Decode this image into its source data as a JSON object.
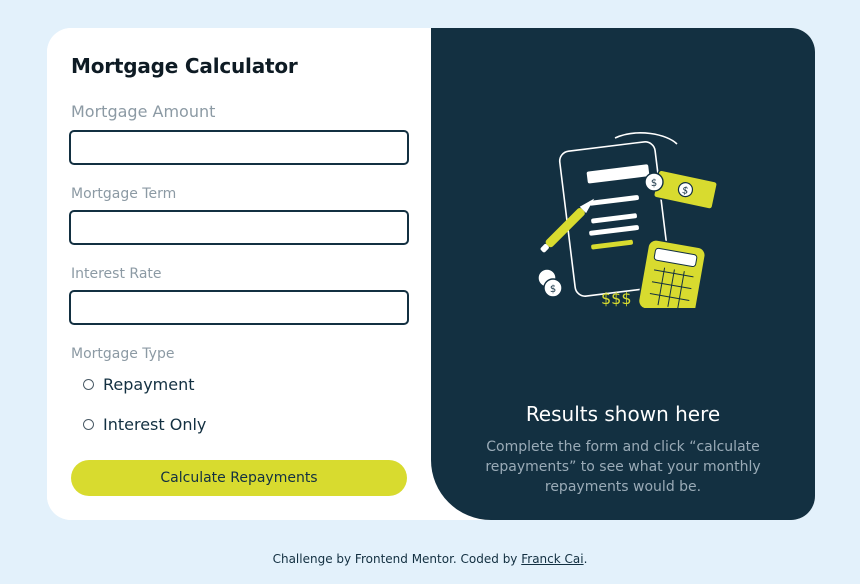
{
  "form": {
    "title": "Mortgage Calculator",
    "amount_label": "Mortgage Amount",
    "term_label": "Mortgage Term",
    "rate_label": "Interest Rate",
    "type_label": "Mortgage Type",
    "amount_value": "",
    "term_value": "",
    "rate_value": "",
    "options": [
      {
        "label": "Repayment",
        "selected": false
      },
      {
        "label": "Interest Only",
        "selected": false
      }
    ],
    "submit_label": "Calculate Repayments"
  },
  "results": {
    "title": "Results shown here",
    "description": "Complete the form and click “calculate repayments” to see what your monthly repayments would be."
  },
  "footer": {
    "prefix": "Challenge by Frontend Mentor. Coded by ",
    "author": "Franck Cai",
    "suffix": "."
  },
  "colors": {
    "background": "#e3f1fb",
    "panel_dark": "#133041",
    "accent_lime": "#d8db2f",
    "text_dark": "#133041",
    "text_muted": "#8c9aa4"
  }
}
